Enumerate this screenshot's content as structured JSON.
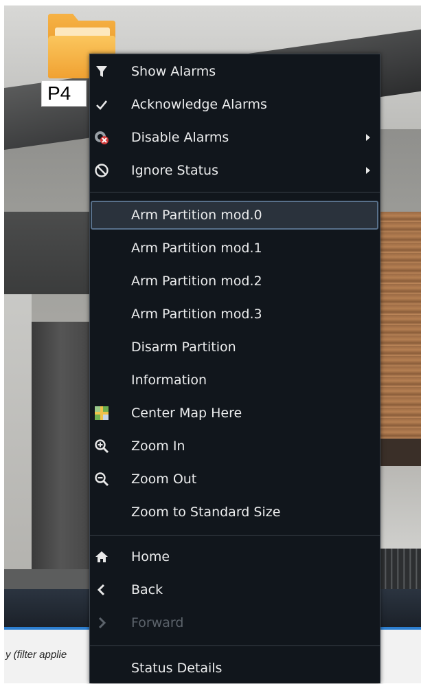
{
  "map": {
    "folder_label": "P4",
    "filter_text": "y (filter applie"
  },
  "menu": {
    "items": [
      {
        "label": "Show Alarms",
        "icon": "filter-icon"
      },
      {
        "label": "Acknowledge Alarms",
        "icon": "checkmark-icon"
      },
      {
        "label": "Disable Alarms",
        "icon": "disable-alarm-icon",
        "submenu": true
      },
      {
        "label": "Ignore Status",
        "icon": "prohibited-icon",
        "submenu": true
      },
      {
        "label": "Arm Partition mod.0",
        "highlighted": true
      },
      {
        "label": "Arm Partition mod.1"
      },
      {
        "label": "Arm Partition mod.2"
      },
      {
        "label": "Arm Partition mod.3"
      },
      {
        "label": "Disarm Partition"
      },
      {
        "label": "Information"
      },
      {
        "label": "Center Map Here",
        "icon": "map-icon"
      },
      {
        "label": "Zoom In",
        "icon": "zoom-in-icon"
      },
      {
        "label": "Zoom Out",
        "icon": "zoom-out-icon"
      },
      {
        "label": "Zoom to Standard Size"
      },
      {
        "label": "Home",
        "icon": "home-icon"
      },
      {
        "label": "Back",
        "icon": "chevron-left-icon"
      },
      {
        "label": "Forward",
        "icon": "chevron-right-icon",
        "disabled": true
      },
      {
        "label": "Status Details"
      }
    ]
  },
  "colors": {
    "menu_bg": "#11161c",
    "highlight_border": "#58708a",
    "accent_blue": "#2d7fd0",
    "folder_orange": "#f3a43a"
  }
}
